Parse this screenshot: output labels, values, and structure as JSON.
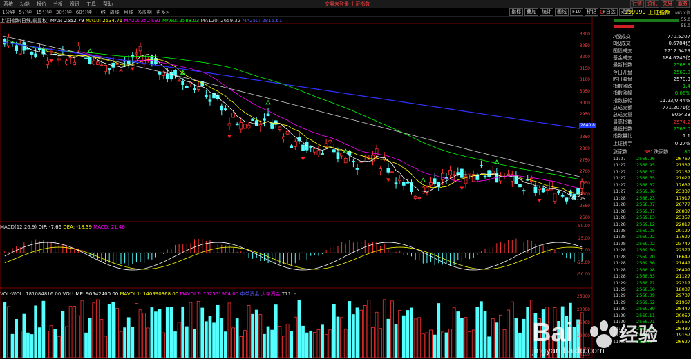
{
  "menu": [
    "系统",
    "功能",
    "报价",
    "分析",
    "资讯",
    "工具",
    "帮助"
  ],
  "window_title": "交易未登录 上证指数",
  "window_buttons": [
    "行情",
    "资讯",
    "交易",
    "服务"
  ],
  "toolbar": [
    "1分钟",
    "5分钟",
    "15分钟",
    "30分钟",
    "60分钟",
    "日线",
    "周线",
    "月线",
    "多周期",
    "更多>"
  ],
  "toolbar_active": "日线",
  "toolbar_right": [
    "指标",
    "叠加",
    "统计",
    "画线",
    "F10",
    "标记",
    "+自选",
    "返回"
  ],
  "main_info": {
    "name": "上证指数(日线,前复权)",
    "ma5": "MA5: 2552.79",
    "ma10": "MA10: 2534.71",
    "ma20": "MA20: 2524.91",
    "ma60": "MA60: 2588.03",
    "ma120": "MA120: 2659.32",
    "ma250": "MA250: 2815.61"
  },
  "price_axis": [
    "3300",
    "3250",
    "3200",
    "3150",
    "3100",
    "3050",
    "3000",
    "2950",
    "2900",
    "2850",
    "2800",
    "2750",
    "2700",
    "2650",
    "2600",
    "2550",
    "2500"
  ],
  "price_marker": "2840.8",
  "cursor_label": "11:35 - 25",
  "macd_info": {
    "label": "MACD(12,26,9)",
    "dif": "DIF: -7.66",
    "dea": "DEA: -18.39",
    "macd": "MACD: 21.46"
  },
  "macd_axis": [
    "50.00",
    "25.00",
    "0.00",
    "-25.00",
    "-50.00"
  ],
  "vol_info": {
    "label": "VOL-WOL: 181084816.00",
    "volume": "VOLUME: 90542400.00",
    "mavol1": "MAVOL1: 140990368.00",
    "mavol2": "MAVOL2: 152551904.00",
    "a": "中单资金",
    "b": "大单资金",
    "t": "T11: -"
  },
  "vol_axis": [
    "25000",
    "20000",
    "15000",
    "10000",
    "5000"
  ],
  "vol_unit": "X100",
  "colors": {
    "up": "#ff3232",
    "down": "#54ffff",
    "ma5": "#ffffff",
    "ma10": "#ffff00",
    "ma20": "#ff00ff",
    "ma60": "#00ff00",
    "ma120": "#cccccc",
    "ma250": "#3232ff"
  },
  "quote_header": {
    "flag": "G",
    "code": "999999",
    "name": "上证指数",
    "link": "MG X位"
  },
  "quote_bars": [
    "55.0",
    "55.0"
  ],
  "quote": [
    {
      "k": "A股成交",
      "v": "770.5207"
    },
    {
      "k": "B股成交",
      "v": "0.6784亿"
    },
    {
      "k": "国债成交",
      "v": "2712.5429"
    },
    {
      "k": "基金成交",
      "v": "184.6246亿"
    },
    {
      "k": "最新指数",
      "v": "2568.8"
    },
    {
      "k": "今日开盘",
      "v": "2569.0"
    },
    {
      "k": "昨日收盘",
      "v": "2570.3"
    },
    {
      "k": "指数涨跌",
      "v": "-1.4"
    },
    {
      "k": "指数涨幅",
      "v": "-0.06%"
    },
    {
      "k": "指数振幅",
      "v": "11.23/0.44%"
    },
    {
      "k": "总成交额",
      "v": "771.2071亿"
    },
    {
      "k": "总成交量",
      "v": "905423"
    },
    {
      "k": "最高指数",
      "v": "2574.2"
    },
    {
      "k": "最低指数",
      "v": "2563.0"
    },
    {
      "k": "指数量比",
      "v": "1.1"
    },
    {
      "k": "上证换手",
      "v": "0.27%"
    }
  ],
  "updown": {
    "up_label": "涨家数",
    "up": "581",
    "down_label": "跌家数",
    "down": "80"
  },
  "ticks": [
    {
      "t": "11:27",
      "p": "2568.96",
      "v": "26767"
    },
    {
      "t": "11:27",
      "p": "2568.95",
      "v": "21537"
    },
    {
      "t": "11:27",
      "p": "2568.37",
      "v": "27157"
    },
    {
      "t": "11:27",
      "p": "2568.65",
      "v": "21027"
    },
    {
      "t": "11:27",
      "p": "2568.37",
      "v": "17637"
    },
    {
      "t": "11:27",
      "p": "2569.86",
      "v": "23337"
    },
    {
      "t": "11:28",
      "p": "2568.23",
      "v": "17917"
    },
    {
      "t": "11:28",
      "p": "2568.07",
      "v": "26777"
    },
    {
      "t": "11:28",
      "p": "2569.37",
      "v": "20837"
    },
    {
      "t": "11:28",
      "p": "2569.13",
      "v": "23357"
    },
    {
      "t": "11:28",
      "p": "2569.12",
      "v": "22817"
    },
    {
      "t": "11:28",
      "p": "2569.05",
      "v": "20127"
    },
    {
      "t": "11:28",
      "p": "2569.22",
      "v": "17627"
    },
    {
      "t": "11:28",
      "p": "2569.02",
      "v": "23747"
    },
    {
      "t": "11:28",
      "p": "2569.50",
      "v": "22577"
    },
    {
      "t": "11:28",
      "p": "2569.70",
      "v": "16647"
    },
    {
      "t": "11:28",
      "p": "2569.36",
      "v": "21447"
    },
    {
      "t": "11:28",
      "p": "2568.98",
      "v": "26497"
    },
    {
      "t": "11:28",
      "p": "2568.83",
      "v": "21127"
    },
    {
      "t": "11:29",
      "p": "2568.71",
      "v": "22217"
    },
    {
      "t": "11:29",
      "p": "2568.60",
      "v": "18037"
    },
    {
      "t": "11:29",
      "p": "2568.89",
      "v": "29737"
    },
    {
      "t": "11:29",
      "p": "2569.62",
      "v": "21967"
    },
    {
      "t": "11:29",
      "p": "2569.30",
      "v": "28447"
    },
    {
      "t": "11:29",
      "p": "2569.11",
      "v": "20057"
    },
    {
      "t": "11:29",
      "p": "2568.71",
      "v": "27557"
    },
    {
      "t": "11:29",
      "p": "2569.24",
      "v": "26487"
    },
    {
      "t": "11:29",
      "p": "2569.07",
      "v": "19167"
    },
    {
      "t": "11:29",
      "p": "2568.84",
      "v": "26627"
    }
  ],
  "watermark": {
    "main": "Bai du 经验",
    "sub": "jingyan.baidu.com"
  }
}
